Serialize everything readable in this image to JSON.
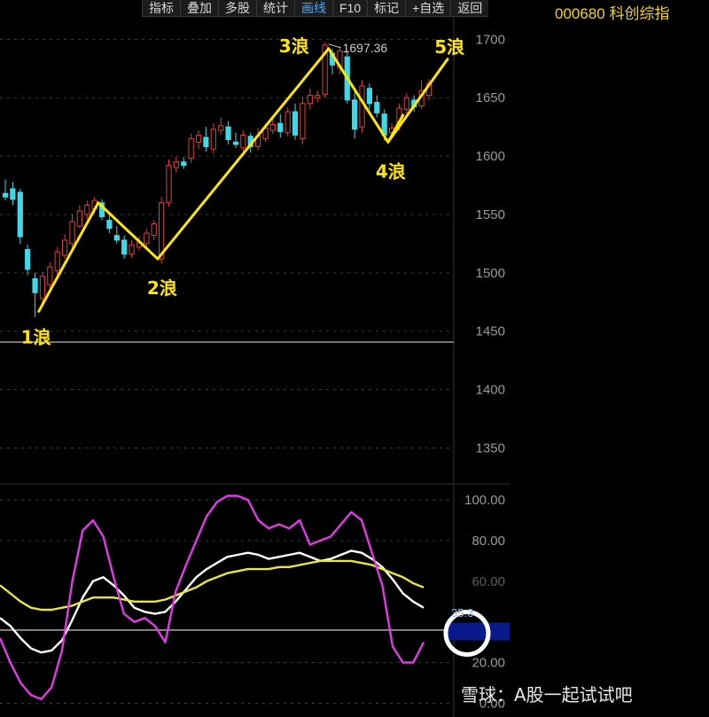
{
  "toolbar": {
    "items": [
      "指标",
      "叠加",
      "多股",
      "统计",
      "画线",
      "F10",
      "标记",
      "+自选",
      "返回"
    ],
    "active": "画线"
  },
  "ticker": "000680 科创综指",
  "watermark": "雪球：A股一起试试吧",
  "colors": {
    "up": "#e04040",
    "down": "#40d8e8",
    "wave": "#ffe600",
    "k": "#ffffff",
    "d": "#e8e83a",
    "j": "#e33ae8",
    "current_box": "#0a1a8a",
    "circle": "#ffffff"
  },
  "chart_data": [
    {
      "type": "candlestick",
      "ylim": [
        1320,
        1720
      ],
      "yticks": [
        1350,
        1400,
        1450,
        1500,
        1550,
        1600,
        1650,
        1700
      ],
      "ytick_labels": [
        "1350",
        "1400",
        "1450",
        "1500",
        "1550",
        "1600",
        "1650",
        "1700"
      ],
      "high_annotation": {
        "text": "1697.36",
        "value": 1697.36
      },
      "candles": [
        [
          1568,
          1565,
          1580,
          1562
        ],
        [
          1572,
          1563,
          1578,
          1558
        ],
        [
          1569,
          1531,
          1572,
          1525
        ],
        [
          1520,
          1503,
          1524,
          1498
        ],
        [
          1495,
          1483,
          1500,
          1462
        ],
        [
          1478,
          1497,
          1501,
          1474
        ],
        [
          1490,
          1505,
          1509,
          1487
        ],
        [
          1502,
          1518,
          1522,
          1498
        ],
        [
          1515,
          1528,
          1533,
          1512
        ],
        [
          1525,
          1544,
          1550,
          1522
        ],
        [
          1540,
          1553,
          1558,
          1538
        ],
        [
          1550,
          1558,
          1562,
          1546
        ],
        [
          1555,
          1562,
          1565,
          1551
        ],
        [
          1560,
          1548,
          1563,
          1545
        ],
        [
          1545,
          1538,
          1550,
          1534
        ],
        [
          1532,
          1528,
          1540,
          1525
        ],
        [
          1528,
          1516,
          1532,
          1512
        ],
        [
          1516,
          1524,
          1528,
          1513
        ],
        [
          1522,
          1526,
          1531,
          1519
        ],
        [
          1525,
          1534,
          1538,
          1522
        ],
        [
          1532,
          1542,
          1545,
          1528
        ],
        [
          1512,
          1560,
          1565,
          1508
        ],
        [
          1560,
          1592,
          1597,
          1557
        ],
        [
          1590,
          1595,
          1600,
          1586
        ],
        [
          1595,
          1592,
          1599,
          1589
        ],
        [
          1598,
          1615,
          1619,
          1594
        ],
        [
          1612,
          1618,
          1622,
          1606
        ],
        [
          1616,
          1608,
          1625,
          1604
        ],
        [
          1606,
          1623,
          1628,
          1602
        ],
        [
          1622,
          1626,
          1633,
          1618
        ],
        [
          1625,
          1614,
          1630,
          1610
        ],
        [
          1612,
          1610,
          1620,
          1607
        ],
        [
          1607,
          1618,
          1622,
          1604
        ],
        [
          1617,
          1608,
          1620,
          1603
        ],
        [
          1608,
          1617,
          1624,
          1605
        ],
        [
          1615,
          1624,
          1628,
          1612
        ],
        [
          1622,
          1627,
          1634,
          1619
        ],
        [
          1628,
          1621,
          1636,
          1616
        ],
        [
          1620,
          1638,
          1642,
          1617
        ],
        [
          1638,
          1618,
          1645,
          1614
        ],
        [
          1615,
          1645,
          1651,
          1610
        ],
        [
          1645,
          1652,
          1658,
          1640
        ],
        [
          1650,
          1652,
          1656,
          1646
        ],
        [
          1653,
          1695,
          1697.36,
          1650
        ],
        [
          1688,
          1678,
          1692,
          1670
        ],
        [
          1676,
          1690,
          1694,
          1670
        ],
        [
          1685,
          1648,
          1690,
          1645
        ],
        [
          1648,
          1623,
          1655,
          1615
        ],
        [
          1625,
          1660,
          1665,
          1620
        ],
        [
          1658,
          1645,
          1662,
          1640
        ],
        [
          1646,
          1637,
          1652,
          1633
        ],
        [
          1636,
          1618,
          1640,
          1613
        ],
        [
          1620,
          1624,
          1628,
          1616
        ],
        [
          1626,
          1641,
          1645,
          1622
        ],
        [
          1640,
          1650,
          1654,
          1636
        ],
        [
          1648,
          1642,
          1652,
          1638
        ],
        [
          1643,
          1656,
          1665,
          1640
        ],
        [
          1652,
          1662,
          1666,
          1648
        ]
      ],
      "annotations": [
        {
          "text": "1浪",
          "point_value": 1467,
          "index": 4.5
        },
        {
          "text": "2浪",
          "point_value": 1512,
          "index": 20.5
        },
        {
          "text": "3浪",
          "point_value": 1692,
          "index": 43.5
        },
        {
          "text": "4浪",
          "point_value": 1612,
          "index": 51.5
        },
        {
          "text": "5浪",
          "point_value": 1685,
          "index": 57.5
        }
      ],
      "wave_path": [
        [
          4.5,
          1467
        ],
        [
          12.5,
          1560
        ],
        [
          20.5,
          1512
        ],
        [
          43.5,
          1692
        ],
        [
          51.5,
          1612
        ],
        [
          53.5,
          1635
        ],
        [
          51.5,
          1612
        ],
        [
          59.5,
          1683
        ]
      ]
    },
    {
      "type": "line",
      "ylim": [
        -5,
        107
      ],
      "yticks": [
        0,
        20,
        40,
        60,
        80,
        100
      ],
      "ytick_labels": [
        "0.00",
        "20.00",
        "",
        "",
        "80.00",
        "100.00"
      ],
      "current_value": "35.3",
      "series": [
        {
          "key": "K",
          "values": [
            42,
            38,
            32,
            27,
            25,
            26,
            31,
            41,
            52,
            60,
            62,
            58,
            53,
            47,
            45,
            44,
            45,
            50,
            56,
            62,
            66,
            69,
            72,
            73,
            74,
            73,
            71,
            72,
            73,
            74,
            72,
            70,
            71,
            73,
            75,
            74,
            71,
            67,
            61,
            54,
            50,
            47
          ]
        },
        {
          "key": "D",
          "values": [
            58,
            54,
            50,
            47,
            46,
            46,
            47,
            48,
            50,
            52,
            52,
            52,
            51,
            50,
            50,
            50,
            51,
            53,
            55,
            57,
            60,
            62,
            64,
            65,
            66,
            66,
            66,
            67,
            67,
            68,
            69,
            70,
            70,
            70,
            70,
            69,
            68,
            66,
            64,
            62,
            59,
            57
          ]
        },
        {
          "key": "J",
          "values": [
            32,
            20,
            10,
            4,
            2,
            8,
            26,
            60,
            85,
            90,
            82,
            62,
            44,
            40,
            42,
            38,
            30,
            55,
            68,
            80,
            92,
            99,
            102,
            102,
            100,
            90,
            86,
            88,
            86,
            90,
            78,
            80,
            82,
            88,
            94,
            90,
            74,
            58,
            28,
            20,
            20,
            30
          ]
        }
      ],
      "hline": 36
    }
  ]
}
